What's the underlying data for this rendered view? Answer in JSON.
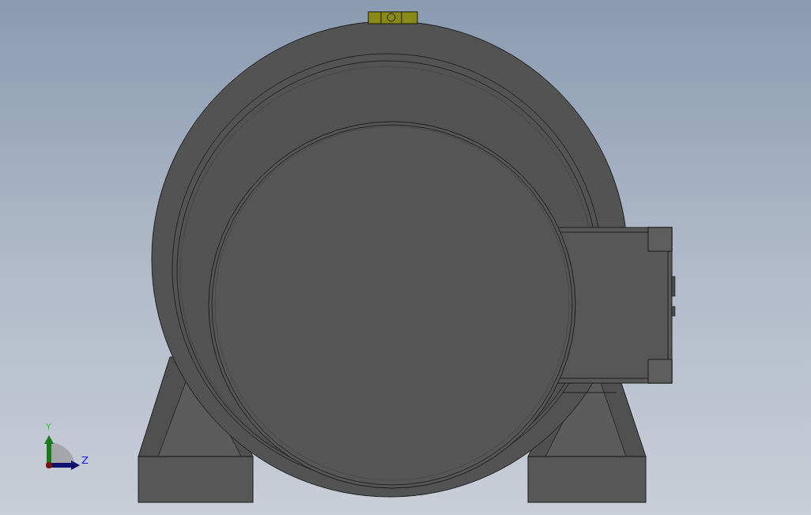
{
  "viewport": {
    "triad": {
      "axes": [
        {
          "label": "Y"
        },
        {
          "label": "Z"
        }
      ]
    }
  }
}
